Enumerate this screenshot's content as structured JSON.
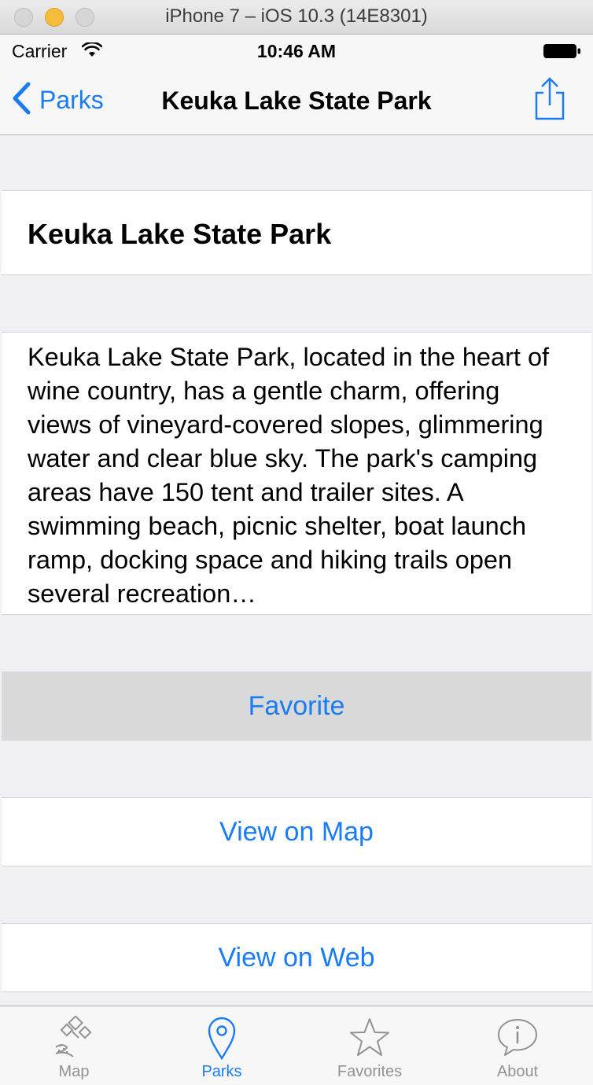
{
  "window": {
    "title": "iPhone 7 – iOS 10.3 (14E8301)"
  },
  "status_bar": {
    "carrier": "Carrier",
    "time": "10:46 AM",
    "wifi_icon": "wifi-icon",
    "battery_icon": "battery-icon"
  },
  "nav_bar": {
    "back_label": "Parks",
    "title": "Keuka Lake State Park",
    "share_icon": "share-icon"
  },
  "park": {
    "name": "Keuka Lake State Park",
    "description": "Keuka Lake State Park, located in the heart of wine country, has a gentle charm, offering views of vineyard-covered slopes, glimmering water and clear blue sky. The park's camping areas have 150 tent and trailer sites. A swimming beach, picnic shelter, boat launch ramp, docking space and hiking trails open several recreation…"
  },
  "actions": {
    "favorite": "Favorite",
    "view_on_map": "View on Map",
    "view_on_web": "View on Web"
  },
  "tab_bar": {
    "tabs": [
      {
        "label": "Map",
        "icon": "map-icon",
        "selected": false
      },
      {
        "label": "Parks",
        "icon": "pin-icon",
        "selected": true
      },
      {
        "label": "Favorites",
        "icon": "star-icon",
        "selected": false
      },
      {
        "label": "About",
        "icon": "info-bubble-icon",
        "selected": false
      }
    ]
  },
  "colors": {
    "accent": "#1a7cf5",
    "inactive": "#929292",
    "background": "#efeff4",
    "highlight": "#d9d9d9"
  }
}
